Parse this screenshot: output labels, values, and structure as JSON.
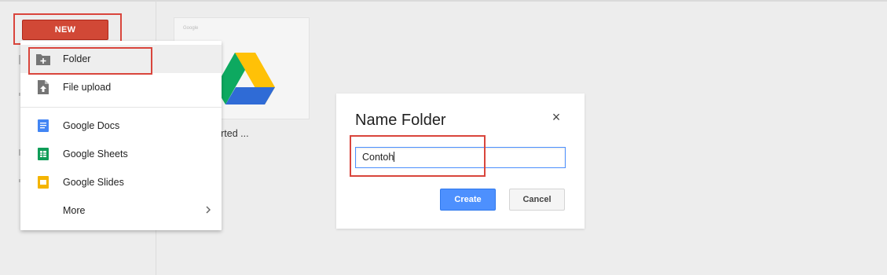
{
  "toolbar": {
    "new_label": "NEW"
  },
  "menu": {
    "items": [
      {
        "label": "Folder",
        "icon": "folder-plus-icon"
      },
      {
        "label": "File upload",
        "icon": "file-upload-icon"
      },
      {
        "label": "Google Docs",
        "icon": "google-docs-icon"
      },
      {
        "label": "Google Sheets",
        "icon": "google-sheets-icon"
      },
      {
        "label": "Google Slides",
        "icon": "google-slides-icon"
      },
      {
        "label": "More",
        "icon": "chevron-right-icon"
      }
    ]
  },
  "file_card": {
    "small_text": "Google",
    "caption": "y to get started ..."
  },
  "dialog": {
    "title": "Name Folder",
    "close_symbol": "×",
    "input_value": "Contoh",
    "create_label": "Create",
    "cancel_label": "Cancel"
  },
  "colors": {
    "new_button": "#d14836",
    "create_button": "#4d90fe",
    "highlight": "#d9453c",
    "docs": "#4285f4",
    "sheets": "#0f9d58",
    "slides": "#f4b400"
  }
}
